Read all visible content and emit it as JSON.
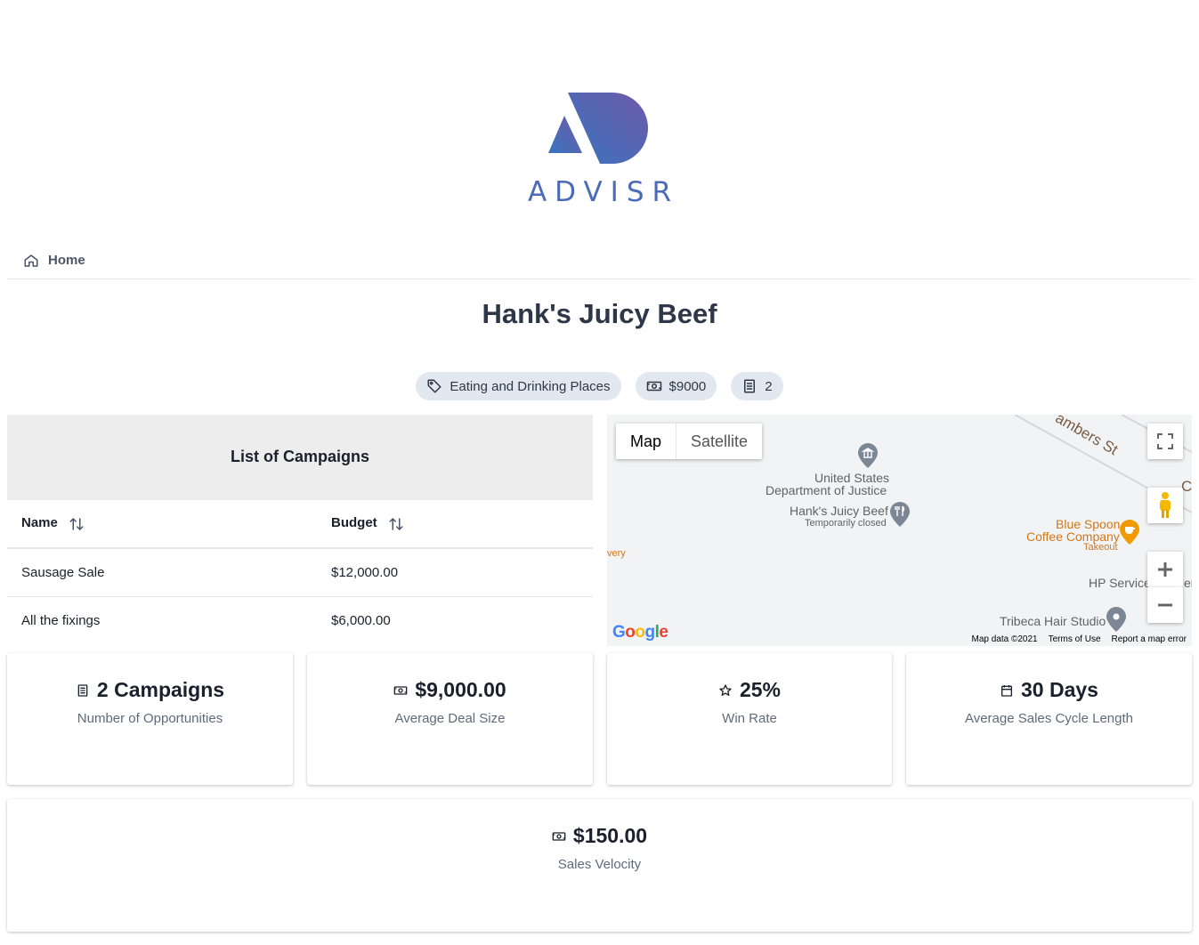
{
  "brand": {
    "name": "ADVISR",
    "colors": {
      "gradient_start": "#3a74bf",
      "gradient_end": "#6e5aa8"
    }
  },
  "breadcrumb": {
    "home_label": "Home",
    "home_icon": "home-icon"
  },
  "page": {
    "title": "Hank's Juicy Beef"
  },
  "tags": [
    {
      "icon": "tag-icon",
      "label": "Eating and Drinking Places"
    },
    {
      "icon": "money-icon",
      "label": "$9000"
    },
    {
      "icon": "document-icon",
      "label": "2"
    }
  ],
  "campaigns": {
    "heading": "List of Campaigns",
    "columns": [
      "Name",
      "Budget"
    ],
    "rows": [
      {
        "name": "Sausage Sale",
        "budget": "$12,000.00"
      },
      {
        "name": "All the fixings",
        "budget": "$6,000.00"
      }
    ]
  },
  "map": {
    "type_options": [
      "Map",
      "Satellite"
    ],
    "selected_type": "Map",
    "street": "ambers St",
    "street_fragment": "C",
    "places": {
      "doj_line1": "United States",
      "doj_line2": "Department of Justice",
      "hanks": "Hank's Juicy Beef",
      "hanks_status": "Temporarily closed",
      "bluespoon_line1": "Blue Spoon",
      "bluespoon_line2": "Coffee Company",
      "bluespoon_status": "Takeout",
      "hp": "HP Service",
      "hp_suffix": "er",
      "tribeca": "Tribeca Hair Studio",
      "left_fragment": "very"
    },
    "logo": "Google",
    "footer": [
      "Map data ©2021",
      "Terms of Use",
      "Report a map error"
    ]
  },
  "stats": [
    {
      "icon": "document-icon",
      "value": "2 Campaigns",
      "label": "Number of Opportunities"
    },
    {
      "icon": "money-icon",
      "value": "$9,000.00",
      "label": "Average Deal Size"
    },
    {
      "icon": "star-icon",
      "value": "25%",
      "label": "Win Rate"
    },
    {
      "icon": "calendar-icon",
      "value": "30 Days",
      "label": "Average Sales Cycle Length"
    }
  ],
  "velocity": {
    "icon": "money-icon",
    "value": "$150.00",
    "label": "Sales Velocity"
  }
}
